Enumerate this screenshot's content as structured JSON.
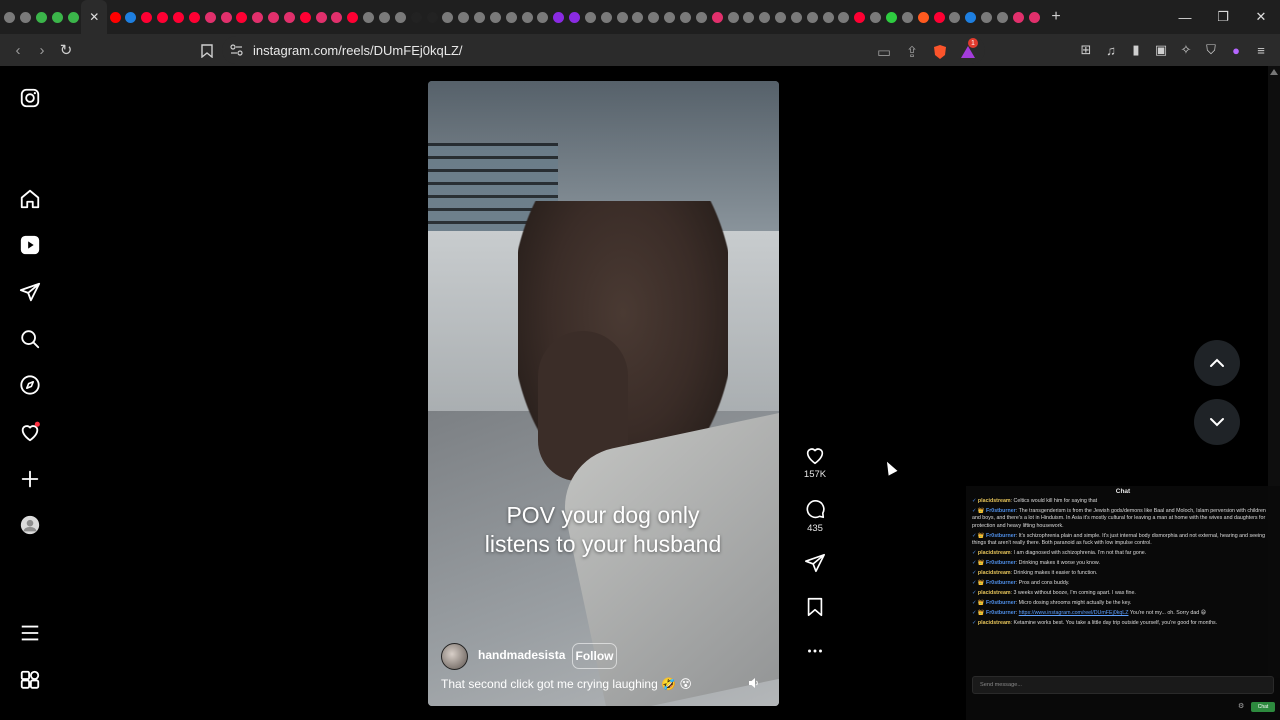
{
  "browser": {
    "tab_icon_colors": [
      "#7a7a7a",
      "#7a7a7a",
      "#3bb54a",
      "#3bb54a",
      "#3bb54a",
      "#ff0000",
      "#1e7fe0",
      "#ff0033",
      "#ff0033",
      "#ff0033",
      "#ff0033",
      "#e1306c",
      "#e1306c",
      "#ff0033",
      "#e1306c",
      "#e1306c",
      "#e1306c",
      "#ff0033",
      "#e1306c",
      "#e1306c",
      "#ff0033",
      "#7a7a7a",
      "#7a7a7a",
      "#7a7a7a",
      "#222222",
      "#222222",
      "#7a7a7a",
      "#7a7a7a",
      "#7a7a7a",
      "#7a7a7a",
      "#7a7a7a",
      "#7a7a7a",
      "#7a7a7a",
      "#8a2be2",
      "#8a2be2",
      "#7a7a7a",
      "#7a7a7a",
      "#7a7a7a",
      "#7a7a7a",
      "#7a7a7a",
      "#7a7a7a",
      "#7a7a7a",
      "#7a7a7a",
      "#e1306c",
      "#7a7a7a",
      "#7a7a7a",
      "#7a7a7a",
      "#7a7a7a",
      "#7a7a7a",
      "#7a7a7a",
      "#7a7a7a",
      "#7a7a7a",
      "#ff0033",
      "#7a7a7a",
      "#2ecc40",
      "#7a7a7a",
      "#ff5a1f",
      "#ff0033",
      "#7a7a7a",
      "#1e7fe0",
      "#7a7a7a",
      "#7a7a7a",
      "#e1306c",
      "#e1306c"
    ],
    "new_tab_icon": "plus-icon",
    "url": "instagram.com/reels/DUmFEj0kqLZ/",
    "notification_badge": "1"
  },
  "reel": {
    "caption_line1": "POV your dog only",
    "caption_line2": "listens to your husband",
    "username": "handmadesista",
    "follow_label": "Follow",
    "description": "That second click got me crying laughing 🤣 😵",
    "likes": "157K",
    "comments": "435"
  },
  "chat": {
    "title": "Chat",
    "messages": [
      {
        "badge": "✓",
        "user": "placidstream",
        "kind": "n1",
        "text": ": Celtics would kill him for saying that"
      },
      {
        "badge": "✓ 👑",
        "user": "Fr0stburner",
        "kind": "n2",
        "text": ": The transgenderism is from the Jewish gods/demons like Baal and Moloch, Islam perversion with children and boys, and there's a lot in Hinduism. In Asia it's mostly cultural for leaving a man at home with the wives and daughters for protection and heavy lifting housework."
      },
      {
        "badge": "✓ 👑",
        "user": "Fr0stburner",
        "kind": "n2",
        "text": ": It's schizophrenia plain and simple. It's just internal body dismorphia and not external, hearing and seeing things that aren't really there. Both paranoid as fuck with low impulse control."
      },
      {
        "badge": "✓",
        "user": "placidstream",
        "kind": "n1",
        "text": ": I am diagnosed with schizophrenia. I'm not that far gone."
      },
      {
        "badge": "✓ 👑",
        "user": "Fr0stburner",
        "kind": "n2",
        "text": ": Drinking makes it worse you know."
      },
      {
        "badge": "✓",
        "user": "placidstream",
        "kind": "n1",
        "text": ": Drinking makes it easier to function."
      },
      {
        "badge": "✓ 👑",
        "user": "Fr0stburner",
        "kind": "n2",
        "text": ": Pros and cons buddy."
      },
      {
        "badge": "✓",
        "user": "placidstream",
        "kind": "n1",
        "text": ": 3 weeks without booze, I'm coming apart. I was fine."
      },
      {
        "badge": "✓ 👑",
        "user": "Fr0stburner",
        "kind": "n2",
        "text": ": Micro dosing shrooms might actually be the key."
      },
      {
        "badge": "✓ 👑",
        "user": "Fr0stburner",
        "kind": "n2",
        "link": "https://www.instagram.com/reel/DUmFEj0kqLZ",
        "text": " You're not my... oh. Sorry dad 😄"
      },
      {
        "badge": "✓",
        "user": "placidstream",
        "kind": "n1",
        "text": ": Ketamine works best. You take a little day trip outside yourself, you're good for months."
      }
    ],
    "input_placeholder": "Send message...",
    "send_label": "Chat"
  }
}
